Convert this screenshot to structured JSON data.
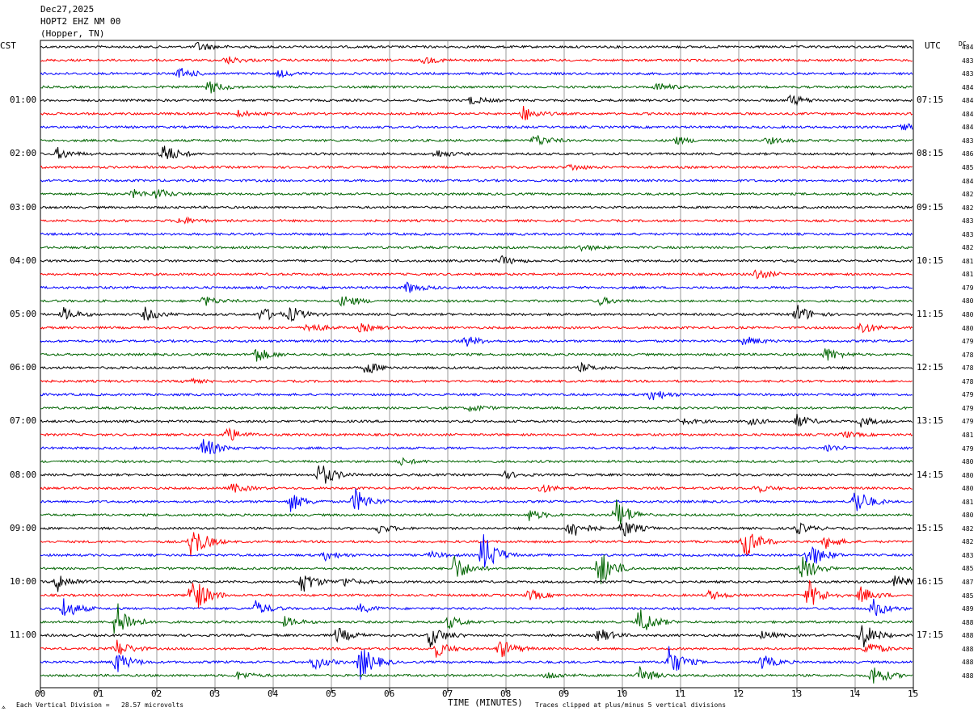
{
  "header": {
    "date": "Dec27,2025",
    "station": "HOPT2 EHZ NM 00",
    "location": "(Hopper, TN)"
  },
  "labels": {
    "left_tz": "CST",
    "right_tz": "UTC",
    "dc": "DC"
  },
  "footer": {
    "left_glyph": "⟑",
    "scale_note": "Each Vertical Division =   28.57 microvolts",
    "clip_note": "Traces clipped at plus/minus 5 vertical divisions"
  },
  "colors": {
    "black": "#000000",
    "red": "#ff0000",
    "blue": "#0000ff",
    "green": "#006400",
    "grid": "#808080"
  },
  "chart_data": {
    "type": "line",
    "title": "",
    "xlabel": "TIME (MINUTES)",
    "xlim": [
      0,
      15
    ],
    "x_ticks": [
      "00",
      "01",
      "02",
      "03",
      "04",
      "05",
      "06",
      "07",
      "08",
      "09",
      "10",
      "11",
      "12",
      "13",
      "14",
      "15"
    ],
    "trace_colors": [
      "black",
      "red",
      "blue",
      "green"
    ],
    "trace_count": 48,
    "left_hour_labels": [
      "01:00",
      "02:00",
      "03:00",
      "04:00",
      "05:00",
      "06:00",
      "07:00",
      "08:00",
      "09:00",
      "10:00",
      "11:00"
    ],
    "right_hour_labels": [
      "07:15",
      "08:15",
      "09:15",
      "10:15",
      "11:15",
      "12:15",
      "13:15",
      "14:15",
      "15:15",
      "16:15",
      "17:15"
    ],
    "dc_offsets": [
      484,
      483,
      483,
      484,
      484,
      484,
      484,
      483,
      486,
      485,
      484,
      482,
      482,
      483,
      483,
      482,
      481,
      481,
      479,
      480,
      480,
      480,
      479,
      478,
      478,
      478,
      479,
      479,
      479,
      481,
      479,
      480,
      480,
      480,
      481,
      480,
      482,
      482,
      483,
      485,
      487,
      485,
      489,
      488,
      488,
      488,
      488,
      488
    ]
  }
}
